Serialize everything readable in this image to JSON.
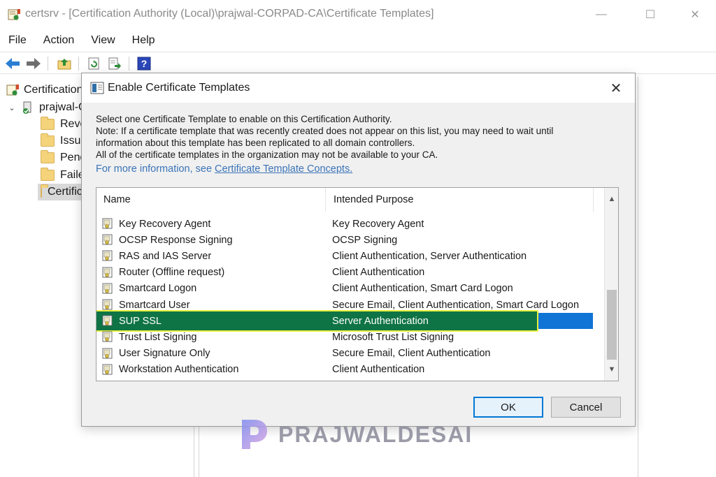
{
  "window": {
    "title": "certsrv - [Certification Authority (Local)\\prajwal-CORPAD-CA\\Certificate Templates]",
    "min_glyph": "—",
    "max_glyph": "☐",
    "close_glyph": "✕"
  },
  "menu": {
    "items": [
      "File",
      "Action",
      "View",
      "Help"
    ]
  },
  "tree": {
    "root": "Certification Authority (Local)",
    "ca": "prajwal-CORPAD-CA",
    "expander": "⌄",
    "folders": [
      "Revoked Certificates",
      "Issued Certificates",
      "Pending Requests",
      "Failed Requests",
      "Certificate Templates"
    ]
  },
  "dialog": {
    "title": "Enable Certificate Templates",
    "close_glyph": "✕",
    "line1": "Select one Certificate Template to enable on this Certification Authority.",
    "line2": "Note: If a certificate template that was recently created does not appear on this list, you may need to wait until",
    "line3": "information about this template has been replicated to all domain controllers.",
    "line4": "All of the certificate templates in the organization may not be available to your CA.",
    "more_info_prefix": "For more information, see ",
    "more_info_link": "Certificate Template Concepts.",
    "columns": {
      "name": "Name",
      "purpose": "Intended Purpose"
    },
    "rows": [
      {
        "name": "Key Recovery Agent",
        "purpose": "Key Recovery Agent"
      },
      {
        "name": "OCSP Response Signing",
        "purpose": "OCSP Signing"
      },
      {
        "name": "RAS and IAS Server",
        "purpose": "Client Authentication, Server Authentication"
      },
      {
        "name": "Router (Offline request)",
        "purpose": "Client Authentication"
      },
      {
        "name": "Smartcard Logon",
        "purpose": "Client Authentication, Smart Card Logon"
      },
      {
        "name": "Smartcard User",
        "purpose": "Secure Email, Client Authentication, Smart Card Logon"
      },
      {
        "name": "SUP SSL",
        "purpose": "Server Authentication"
      },
      {
        "name": "Trust List Signing",
        "purpose": "Microsoft Trust List Signing"
      },
      {
        "name": "User Signature Only",
        "purpose": "Secure Email, Client Authentication"
      },
      {
        "name": "Workstation Authentication",
        "purpose": "Client Authentication"
      }
    ],
    "selected_index": 6,
    "scroll_up_glyph": "▲",
    "scroll_down_glyph": "▼",
    "ok_label": "OK",
    "cancel_label": "Cancel"
  },
  "watermark": {
    "text": "PRAJWALDESAI"
  },
  "colors": {
    "selection": "#0f74d6",
    "highlight": "#0e7345",
    "highlight_border": "#e8ef3f",
    "link": "#3a73b8"
  }
}
